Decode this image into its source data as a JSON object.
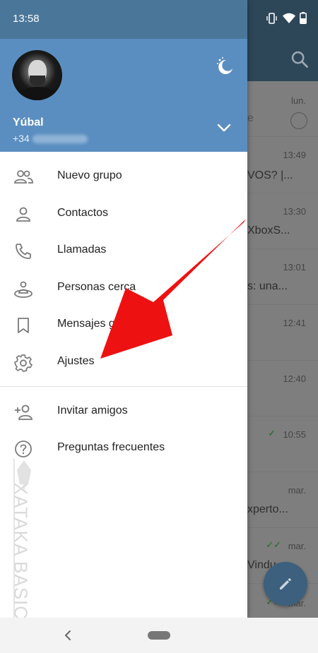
{
  "status_bar": {
    "time": "13:58"
  },
  "drawer": {
    "user": {
      "name": "Yúbal",
      "phone_prefix": "+34"
    },
    "items": [
      {
        "label": "Nuevo grupo",
        "icon": "group-icon"
      },
      {
        "label": "Contactos",
        "icon": "contact-icon"
      },
      {
        "label": "Llamadas",
        "icon": "phone-icon"
      },
      {
        "label": "Personas cerca",
        "icon": "people-nearby-icon"
      },
      {
        "label": "Mensajes guardados",
        "icon": "bookmark-icon"
      },
      {
        "label": "Ajustes",
        "icon": "settings-icon"
      },
      {
        "label": "Invitar amigos",
        "icon": "add-person-icon"
      },
      {
        "label": "Preguntas frecuentes",
        "icon": "help-icon"
      }
    ]
  },
  "chat_list": {
    "rows": [
      {
        "time": "lun.",
        "snippet": ""
      },
      {
        "time": "13:49",
        "snippet": "VOS? |..."
      },
      {
        "time": "13:30",
        "snippet": "XboxS..."
      },
      {
        "time": "13:01",
        "snippet": "s: una..."
      },
      {
        "time": "12:41",
        "snippet": ""
      },
      {
        "time": "12:40",
        "snippet": ""
      },
      {
        "time": "10:55",
        "snippet": ""
      },
      {
        "time": "mar.",
        "snippet": "xperto..."
      },
      {
        "time": "mar.",
        "snippet": "Vindu..."
      },
      {
        "time": "mar.",
        "snippet": ""
      }
    ]
  },
  "watermark": {
    "text": "XATAKA BASICS"
  },
  "colors": {
    "header": "#5b8ec0",
    "status": "#4a7799",
    "arrow": "#ee1111"
  }
}
